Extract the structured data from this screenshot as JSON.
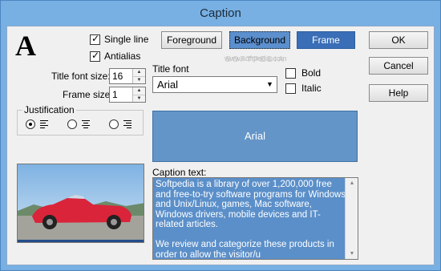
{
  "window": {
    "title": "Caption"
  },
  "options": {
    "single_line": {
      "label": "Single line",
      "checked": true
    },
    "antialias": {
      "label": "Antialias",
      "checked": true
    },
    "bold": {
      "label": "Bold",
      "checked": false
    },
    "italic": {
      "label": "Italic",
      "checked": false
    }
  },
  "title_font_size": {
    "label": "Title font size:",
    "value": "16"
  },
  "frame_size": {
    "label": "Frame size:",
    "value": "1"
  },
  "justification": {
    "label": "Justification",
    "selected": "left"
  },
  "color_buttons": {
    "foreground": "Foreground",
    "background": "Background",
    "frame": "Frame"
  },
  "dialog_buttons": {
    "ok": "OK",
    "cancel": "Cancel",
    "help": "Help"
  },
  "title_font": {
    "label": "Title font",
    "value": "Arial"
  },
  "preview": {
    "text": "Arial"
  },
  "caption": {
    "label": "Caption text:",
    "text": "Softpedia is a library of over 1,200,000 free and free-to-try software programs for Windows and Unix/Linux, games, Mac software, Windows drivers, mobile devices and IT-related articles.\n\nWe review and categorize these products in order to allow the visitor/u"
  },
  "watermark": "SOFTPEDIA",
  "watermark_url": "www.softpedia.com",
  "colors": {
    "preview_bg": "#6495c8",
    "frame": "#3a6eb6",
    "background_btn": "#5b8fcd",
    "caption_bg": "#5b8fc9"
  },
  "icons": [
    "check-icon",
    "spin-up-icon",
    "spin-down-icon",
    "dropdown-arrow-icon",
    "align-left-icon",
    "align-center-icon",
    "align-right-icon",
    "scroll-up-icon",
    "scroll-down-icon"
  ]
}
